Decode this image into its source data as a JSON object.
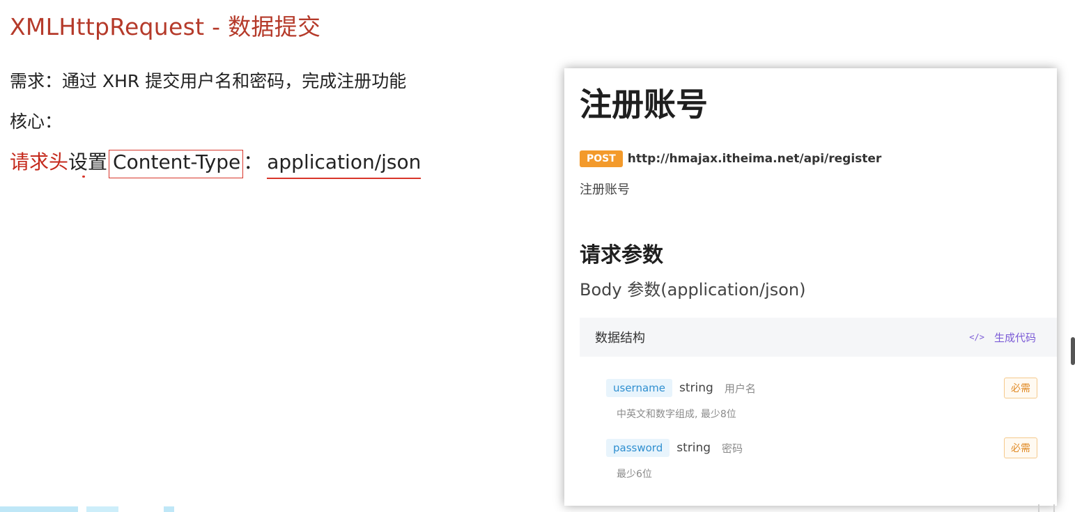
{
  "slide": {
    "title": "XMLHttpRequest - 数据提交",
    "requirement": "需求：通过 XHR 提交用户名和密码，完成注册功能",
    "core_label": "核心：",
    "header_line": {
      "highlight": "请求头",
      "verb": "设置",
      "boxed": "Content-Type",
      "colon": "：",
      "value": "application/json"
    }
  },
  "doc": {
    "title": "注册账号",
    "method": "POST",
    "url": "http://hmajax.itheima.net/api/register",
    "description": "注册账号",
    "params_heading": "请求参数",
    "body_heading": "Body 参数(application/json)",
    "schema": {
      "title": "数据结构",
      "gen_code_icon": "</>",
      "gen_code_label": "生成代码",
      "fields": [
        {
          "name": "username",
          "type": "string",
          "label": "用户名",
          "required": "必需",
          "note": "中英文和数字组成, 最少8位"
        },
        {
          "name": "password",
          "type": "string",
          "label": "密码",
          "required": "必需",
          "note": "最少6位"
        }
      ]
    }
  },
  "colors": {
    "title_red": "#b53a2a",
    "accent_red": "#d8352a",
    "post_orange": "#f39a2b",
    "field_blue": "#2f8fd0",
    "gen_code_purple": "#7b5bd6"
  }
}
